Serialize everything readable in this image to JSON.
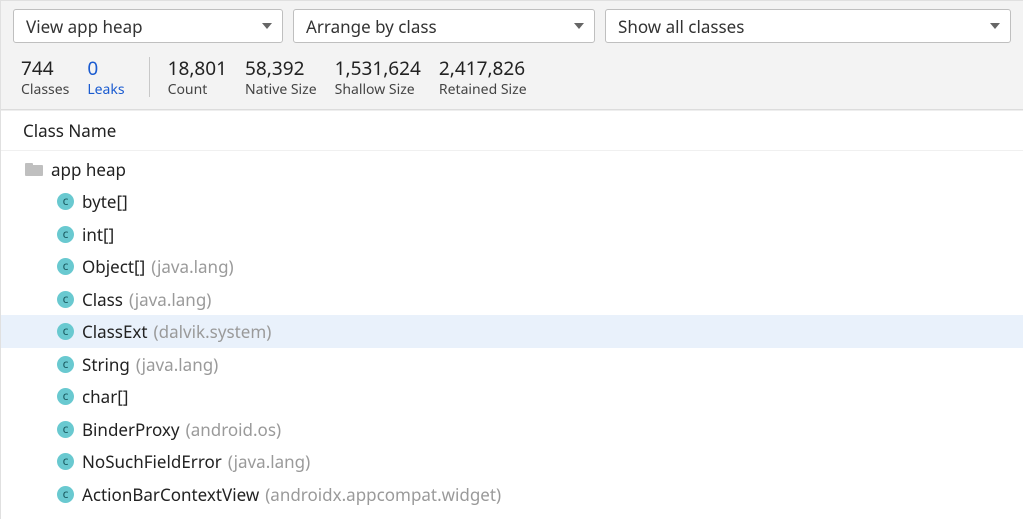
{
  "dropdowns": {
    "heap": "View app heap",
    "arrange": "Arrange by class",
    "filter": "Show all classes"
  },
  "stats": {
    "classes": {
      "value": "744",
      "label": "Classes"
    },
    "leaks": {
      "value": "0",
      "label": "Leaks"
    },
    "count": {
      "value": "18,801",
      "label": "Count"
    },
    "native": {
      "value": "58,392",
      "label": "Native Size"
    },
    "shallow": {
      "value": "1,531,624",
      "label": "Shallow Size"
    },
    "retained": {
      "value": "2,417,826",
      "label": "Retained Size"
    }
  },
  "section_header": "Class Name",
  "root_label": "app heap",
  "rows": [
    {
      "name": "byte[]",
      "pkg": "",
      "selected": false
    },
    {
      "name": "int[]",
      "pkg": "",
      "selected": false
    },
    {
      "name": "Object[]",
      "pkg": "(java.lang)",
      "selected": false
    },
    {
      "name": "Class",
      "pkg": "(java.lang)",
      "selected": false
    },
    {
      "name": "ClassExt",
      "pkg": "(dalvik.system)",
      "selected": true
    },
    {
      "name": "String",
      "pkg": "(java.lang)",
      "selected": false
    },
    {
      "name": "char[]",
      "pkg": "",
      "selected": false
    },
    {
      "name": "BinderProxy",
      "pkg": "(android.os)",
      "selected": false
    },
    {
      "name": "NoSuchFieldError",
      "pkg": "(java.lang)",
      "selected": false
    },
    {
      "name": "ActionBarContextView",
      "pkg": "(androidx.appcompat.widget)",
      "selected": false
    }
  ]
}
